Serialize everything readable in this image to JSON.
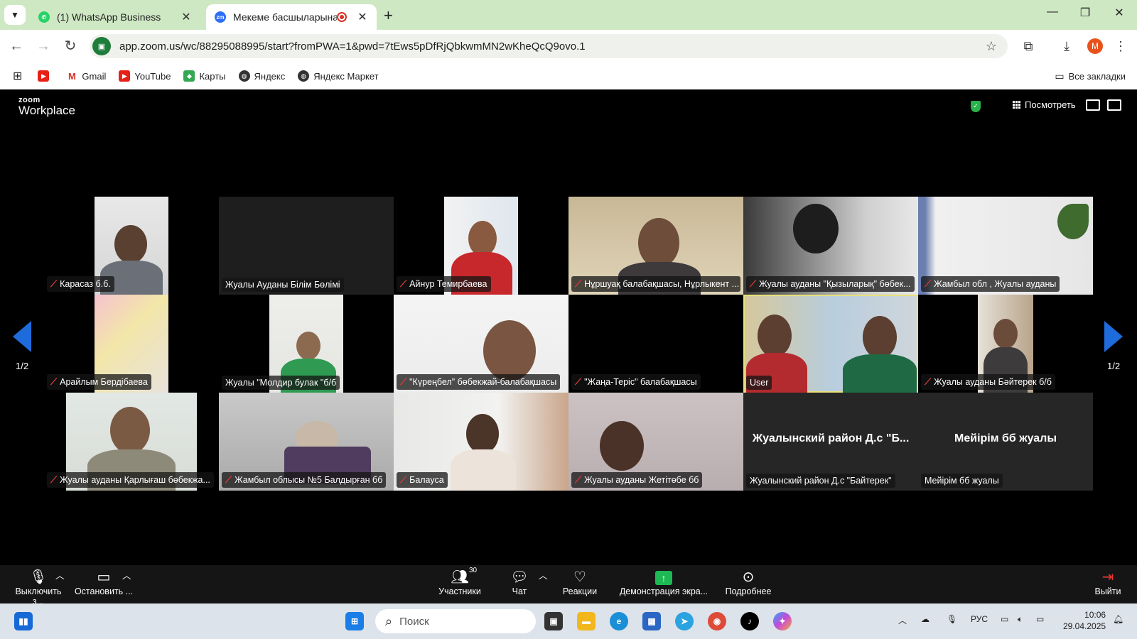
{
  "browser": {
    "tabs": [
      {
        "title": "(1) WhatsApp Business",
        "icon": "whatsapp-icon"
      },
      {
        "title": "Мекеме басшыларына",
        "icon": "zoom-icon"
      }
    ],
    "url": "app.zoom.us/wc/88295088995/start?fromPWA=1&pwd=7tEws5pDfRjQbkwmMN2wKheQcQ9ovo.1",
    "avatar_letter": "M",
    "bookmarks": [
      "Gmail",
      "YouTube",
      "Карты",
      "Яндекс",
      "Яндекс Маркет"
    ],
    "all_bookmarks": "Все закладки"
  },
  "zoom": {
    "brand_top": "zoom",
    "brand_name": "Workplace",
    "view_label": "Посмотреть",
    "page_indicator": "1/2",
    "participants": [
      {
        "name": "Карасаз б.б.",
        "muted": true
      },
      {
        "name": "Жуалы Ауданы Білім Бөлімі",
        "muted": false
      },
      {
        "name": "Айнур Темирбаева",
        "muted": true
      },
      {
        "name": "Нұршуақ балабақшасы, Нұрлыкент ...",
        "muted": true
      },
      {
        "name": "Жуалы ауданы \"Қызыларық\" бөбек...",
        "muted": true
      },
      {
        "name": "Жамбыл обл , Жуалы ауданы",
        "muted": true
      },
      {
        "name": "Арайлым Бердібаева",
        "muted": true
      },
      {
        "name": "Жуалы \"Молдир булак \"б/б",
        "muted": false
      },
      {
        "name": "\"Күреңбел\" бөбекжай-балабақшасы",
        "muted": true
      },
      {
        "name": "\"Жаңа-Теріс\" балабақшасы",
        "muted": true
      },
      {
        "name": "User",
        "muted": false
      },
      {
        "name": "Жуалы ауданы Бәйтерек б/б",
        "muted": true
      },
      {
        "name": "Жуалы ауданы Қарлығаш бөбекжа...",
        "muted": true
      },
      {
        "name": "Жамбыл облысы №5 Балдырған бб",
        "muted": true
      },
      {
        "name": "Балауса",
        "muted": true
      },
      {
        "name": "Жуалы ауданы Жетітөбе бб",
        "muted": true
      },
      {
        "name": "Жуалынский район Д.с \"Байтерек\"",
        "muted": false,
        "display": "Жуалынский район Д.с \"Б..."
      },
      {
        "name": "Мейірім бб жуалы",
        "muted": false,
        "display": "Мейірім бб жуалы"
      }
    ],
    "toolbar": {
      "mic": "Выключить з...",
      "video": "Остановить ...",
      "participants": "Участники",
      "participants_count": "30",
      "chat": "Чат",
      "reactions": "Реакции",
      "share": "Демонстрация экра...",
      "more": "Подробнее",
      "leave": "Выйти"
    }
  },
  "taskbar": {
    "search_placeholder": "Поиск",
    "language": "РУС",
    "time": "10:06",
    "date": "29.04.2025"
  }
}
